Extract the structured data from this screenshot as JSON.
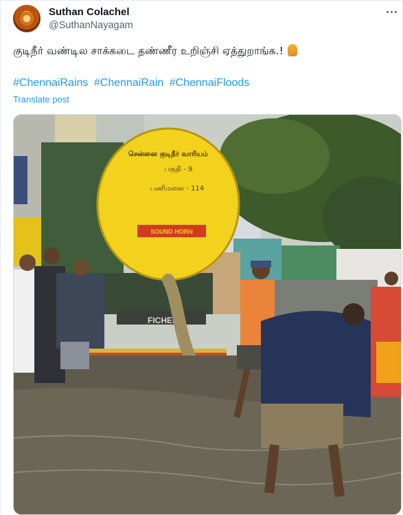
{
  "author": {
    "display_name": "Suthan Colachel",
    "handle": "@SuthanNayagam"
  },
  "tweet": {
    "text": "குடிநீர் வண்டில சாக்கடை தண்ணீர உறிஞ்சி ஏத்துறாங்க.!",
    "emoji": "facepalm-emoji",
    "hashtags": [
      "#ChennaiRains",
      "#ChennaiRain",
      "#ChennaiFloods"
    ],
    "translate_label": "Translate post"
  },
  "photo": {
    "tanker_text_line1": "சென்னை குடிநீர் வாரியம்",
    "tanker_text_line2": "பகுதி - 9",
    "tanker_text_line3": "பணிமனை - 114",
    "bumper_text": "FICHER",
    "brand_text": "SOUND HORN"
  }
}
